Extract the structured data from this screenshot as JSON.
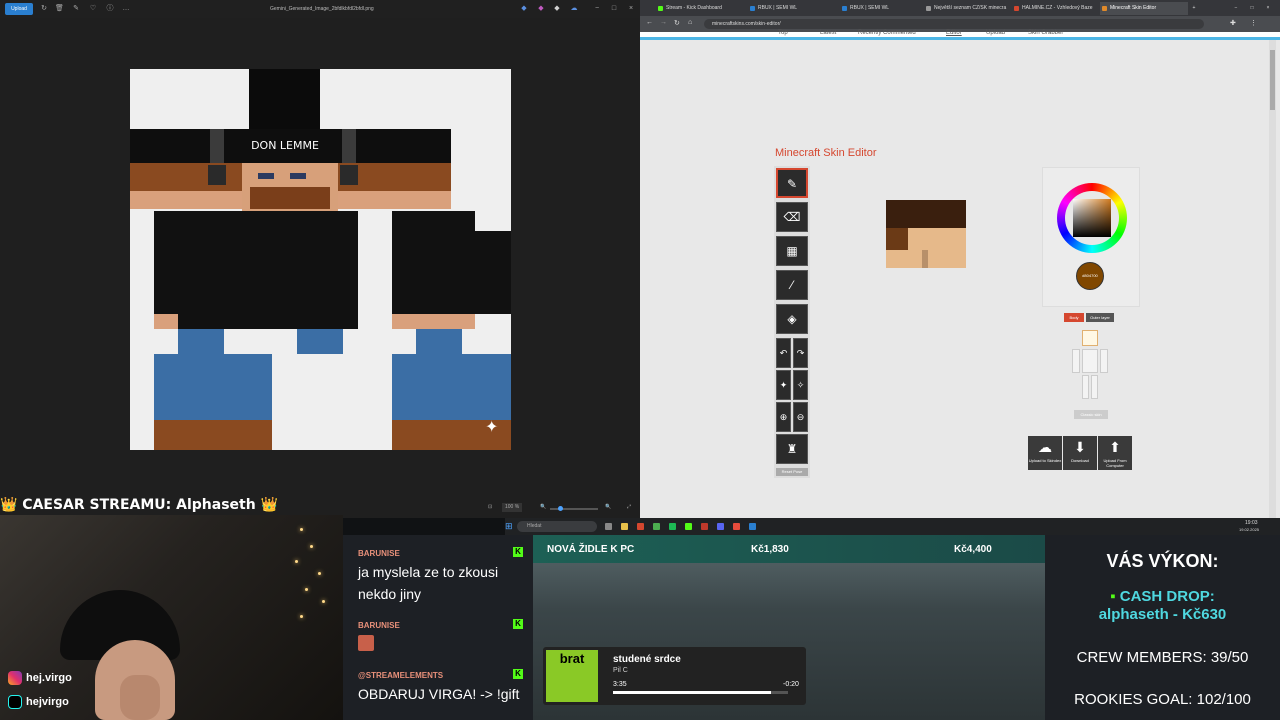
{
  "viewer": {
    "upload_label": "Upload",
    "file_title": "Gemini_Generated_Image_2bfdlkbfdl2bfdl.png",
    "zoom": "100 %",
    "skin_text": "DON LEMME"
  },
  "caption": "👑 CAESAR STREAMU: Alphaseth 👑",
  "browser": {
    "tabs": [
      {
        "label": "Stream - Kick Dashboard",
        "color": "#53fc18"
      },
      {
        "label": "RBUX | SEMI WL",
        "color": "#2a7fd0"
      },
      {
        "label": "RBUX | SEMI WL",
        "color": "#2a7fd0"
      },
      {
        "label": "Největší seznam CZ/SK minecra",
        "color": "#999"
      },
      {
        "label": "HALMINE.CZ - Vzhledový Baze",
        "color": "#d5472f"
      },
      {
        "label": "Minecraft Skin Editor",
        "color": "#e08a2a"
      }
    ],
    "url": "minecraftskins.com/skin-editor/",
    "nav": [
      "Top",
      "Latest",
      "Recently Commented",
      "Editor",
      "Upload",
      "Skin Grabber"
    ],
    "editor_title": "Minecraft Skin Editor",
    "color_hex": "#804700",
    "layer_body": "Body",
    "layer_outer": "Outer layer",
    "reset_pose": "Reset Pose",
    "classic_skin": "Classic skin",
    "downloads": [
      {
        "label": "Upload to Skindex",
        "icon": "upload-skindex-icon"
      },
      {
        "label": "Download",
        "icon": "download-icon"
      },
      {
        "label": "Upload From Computer",
        "icon": "upload-computer-icon"
      }
    ]
  },
  "taskbar": {
    "search": "Hledat",
    "time": "19:03",
    "date": "19.02.2025"
  },
  "social": {
    "instagram": "hej.virgo",
    "tiktok": "hejvirgo"
  },
  "chat": [
    {
      "user": "BARUNISE",
      "message": "ja myslela ze to zkousi nekdo jiny"
    },
    {
      "user": "BARUNISE",
      "message": ""
    },
    {
      "user": "@STREAMELEMENTS",
      "message": "OBDARUJ VIRGA! -> !gift"
    }
  ],
  "goal": {
    "title": "NOVÁ ŽIDLE K PC",
    "current": "Kč1,830",
    "target": "Kč4,400"
  },
  "music": {
    "album": "brat",
    "song": "studené srdce",
    "artist": "Pil C",
    "elapsed": "3:35",
    "remaining": "-0:20",
    "progress": 0.9
  },
  "stats": {
    "title": "VÁS VÝKON:",
    "cash_drop_label": "CASH DROP:",
    "cash_drop_value": "alphaseth - Kč630",
    "crew": "CREW MEMBERS: 39/50",
    "rookies": "ROOKIES GOAL: 102/100"
  }
}
